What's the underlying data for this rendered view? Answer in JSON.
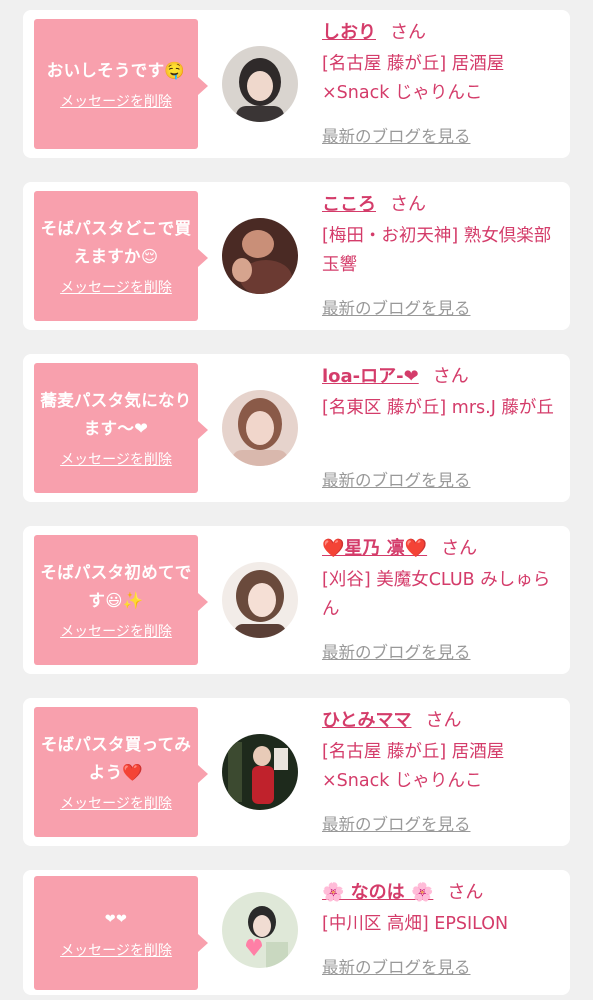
{
  "delete_label": "メッセージを削除",
  "blog_label": "最新のブログを見る",
  "san": "さん",
  "cards": [
    {
      "message": "おいしそうです🤤",
      "name": "しおり",
      "shop": "[名古屋 藤が丘] 居酒屋×Snack じゃりんこ"
    },
    {
      "message": "そばパスタどこで買えますか😌",
      "name": "こころ",
      "shop": "[梅田・お初天神] 熟女倶楽部 玉響"
    },
    {
      "message": "蕎麦パスタ気になります〜❤",
      "name": "loa-ロア-❤",
      "shop": "[名東区 藤が丘] mrs.J 藤が丘"
    },
    {
      "message": "そばパスタ初めてです😃✨",
      "name": "❤️星乃 凛❤️",
      "shop": "[刈谷] 美魔女CLUB みしゅらん"
    },
    {
      "message": "そばパスタ買ってみよう❤️",
      "name": "ひとみママ",
      "shop": "[名古屋 藤が丘] 居酒屋×Snack じゃりんこ"
    },
    {
      "message": "❤❤",
      "name": "🌸 なのは 🌸",
      "shop": "[中川区 高畑] EPSILON"
    }
  ]
}
